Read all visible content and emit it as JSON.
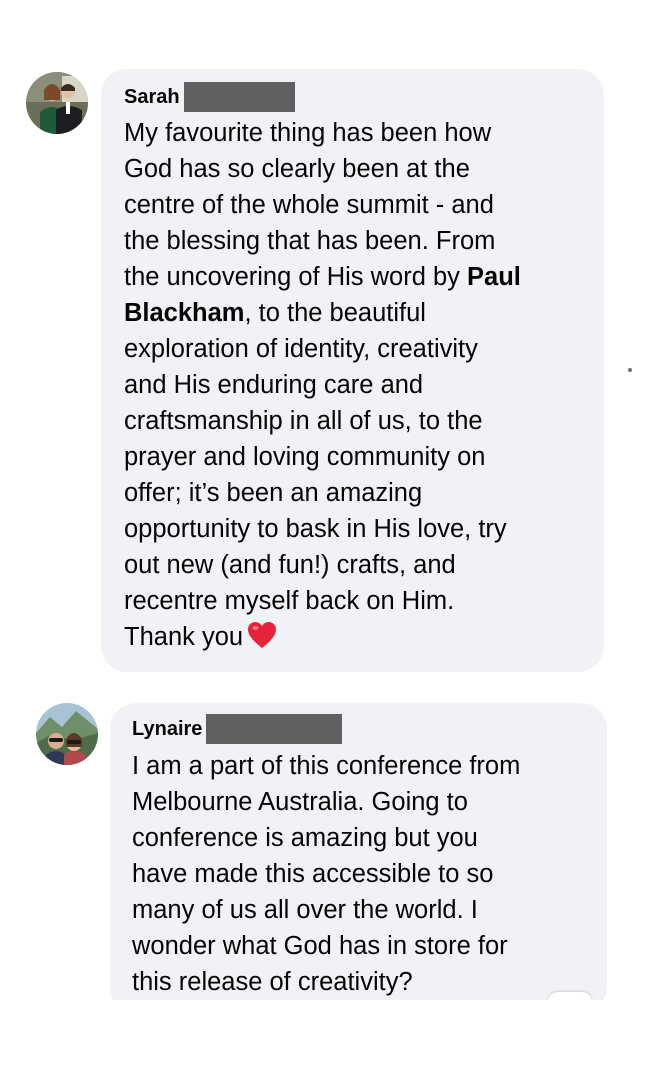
{
  "comments": [
    {
      "author": "Sarah",
      "avatar": "profile-photo-couple",
      "text_lines": [
        "My favourite thing has been how",
        "God has so clearly been at the",
        "centre of the whole summit - and",
        "the blessing that has been. From",
        "the uncovering of His word by ",
        "Paul",
        "Blackham",
        ", to the beautiful",
        "exploration of identity, creativity",
        "and His enduring care and",
        "craftsmanship in all of us, to the",
        "prayer and loving community on",
        "offer; it’s been an amazing",
        "opportunity to bask in His love, try",
        "out new (and fun!) crafts, and",
        "recentre myself back on Him.",
        "Thank you"
      ],
      "mention": "Paul Blackham",
      "trailing_icon": "red-heart-emoji"
    },
    {
      "author": "Lynaire",
      "avatar": "profile-photo-selfie-mountains",
      "text_lines": [
        "I am a part of this conference from",
        "Melbourne Australia. Going to",
        "conference is amazing but you",
        "have made this accessible to so",
        "many of us all over the world. I",
        "wonder what God has in store for",
        "this release of creativity?"
      ]
    }
  ],
  "colors": {
    "bubble": "#f0f2f5",
    "text": "#050505",
    "redaction": "#606060",
    "heart": "#e0245e"
  }
}
